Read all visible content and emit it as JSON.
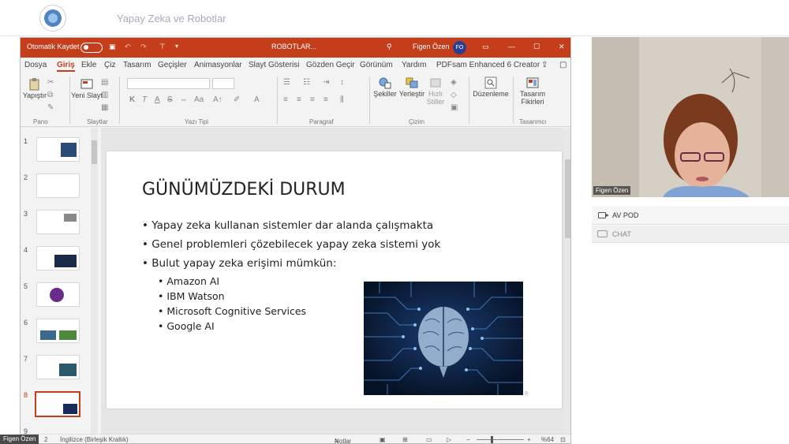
{
  "app": {
    "title": "Yapay Zeka ve Robotlar"
  },
  "ppt": {
    "autosave_label": "Otomatik Kaydet",
    "file_name": "ROBOTLAR...",
    "user_name": "Figen Özen",
    "user_initials": "FO",
    "menu": [
      "Dosya",
      "Giriş",
      "Ekle",
      "Çiz",
      "Tasarım",
      "Geçişler",
      "Animasyonlar",
      "Slayt Gösterisi",
      "Gözden Geçir",
      "Görünüm",
      "Yardım",
      "PDFsam Enhanced 6 Creator"
    ],
    "active_menu": "Giriş",
    "ribbon": {
      "paste": "Yapıştır",
      "new_slide": "Yeni Slayt",
      "shapes": "Şekiller",
      "arrange": "Yerleştir",
      "quick_styles": "Hızlı Stiller",
      "editing": "Düzenleme",
      "designer": "Tasarım Fikirleri",
      "groups": [
        "Pano",
        "Slaytlar",
        "Yazı Tipi",
        "Paragraf",
        "Çizim",
        "Tasarımcı"
      ]
    },
    "thumbnails": [
      "1",
      "2",
      "3",
      "4",
      "5",
      "6",
      "7",
      "8",
      "9"
    ],
    "selected_thumbnail": "8",
    "slide": {
      "title": "GÜNÜMÜZDEKİ DURUM",
      "bullets": [
        "Yapay zeka kullanan sistemler dar alanda çalışmakta",
        "Genel problemleri çözebilecek yapay zeka sistemi yok",
        "Bulut yapay zeka erişimi mümkün:"
      ],
      "sub_bullets": [
        "Amazon AI",
        "IBM Watson",
        "Microsoft Cognitive Services",
        "Google AI"
      ],
      "page_number": "8"
    },
    "status": {
      "slide_info": "2",
      "language": "İngilizce (Birleşik Krallık)",
      "notes": "Notlar",
      "zoom": "%64"
    }
  },
  "right": {
    "video_name": "Figen Özen",
    "av_pod": "AV POD",
    "chat": "CHAT"
  },
  "bottom_name": "Figen Özen"
}
